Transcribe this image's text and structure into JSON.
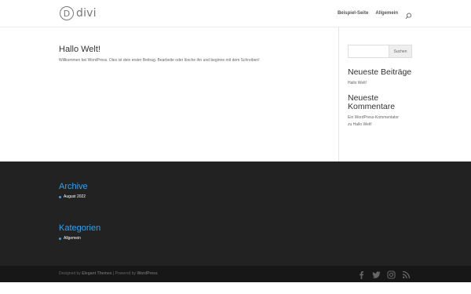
{
  "header": {
    "logo_letter": "D",
    "logo_text": "divi",
    "nav": [
      {
        "label": "Beispiel-Seite"
      },
      {
        "label": "Allgemein"
      }
    ]
  },
  "post": {
    "title": "Hallo Welt!",
    "excerpt": "Willkommen bei WordPress. Dies ist dein erster Beitrag. Bearbeite oder lösche ihn und beginne mit dem Schreiben!"
  },
  "sidebar": {
    "search_placeholder": "",
    "search_button": "Suchen",
    "recent_posts_title": "Neueste Beiträge",
    "recent_posts": [
      "Hallo Welt!"
    ],
    "recent_comments_title": "Neueste Kommentare",
    "recent_comment_author": "Ein WordPress-Kommentator",
    "recent_comment_joiner": "zu",
    "recent_comment_post": "Hallo Welt!"
  },
  "footer": {
    "archive_title": "Archive",
    "archive_items": [
      "August 2022"
    ],
    "categories_title": "Kategorien",
    "category_items": [
      "Allgemein"
    ],
    "credits_prefix": "Designed by",
    "credits_designer": "Elegant Themes",
    "credits_sep": "|",
    "credits_powered": "Powered by",
    "credits_platform": "WordPress",
    "social_icons": [
      "facebook-icon",
      "twitter-icon",
      "instagram-icon",
      "rss-icon"
    ]
  },
  "colors": {
    "accent": "#2ea3f2",
    "footer_bg": "#222222",
    "bottom_bar_bg": "#171717"
  }
}
